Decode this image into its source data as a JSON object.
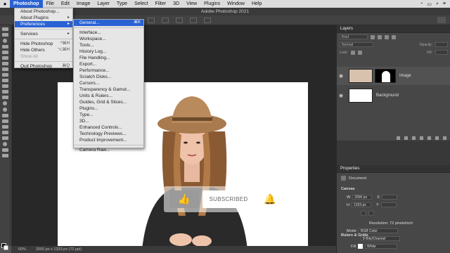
{
  "menubar": {
    "items": [
      "Photoshop",
      "File",
      "Edit",
      "Image",
      "Layer",
      "Type",
      "Select",
      "Filter",
      "3D",
      "View",
      "Plugins",
      "Window",
      "Help"
    ]
  },
  "title": "Adobe Photoshop 2021",
  "photoshop_menu": {
    "items": [
      {
        "label": "About Photoshop...",
        "shortcut": ""
      },
      {
        "label": "About Plugins",
        "shortcut": "▸"
      },
      {
        "label": "Preferences",
        "shortcut": "▸"
      },
      {
        "label": "Services",
        "shortcut": "▸"
      },
      {
        "label": "Hide Photoshop",
        "shortcut": "^⌘H"
      },
      {
        "label": "Hide Others",
        "shortcut": "⌥⌘H"
      },
      {
        "label": "Show All",
        "shortcut": ""
      },
      {
        "label": "Quit Photoshop",
        "shortcut": "⌘Q"
      }
    ]
  },
  "preferences_menu": {
    "items": [
      {
        "label": "General...",
        "shortcut": "⌘K"
      },
      {
        "label": "Interface..."
      },
      {
        "label": "Workspace..."
      },
      {
        "label": "Tools..."
      },
      {
        "label": "History Log..."
      },
      {
        "label": "File Handling..."
      },
      {
        "label": "Export..."
      },
      {
        "label": "Performance..."
      },
      {
        "label": "Scratch Disks..."
      },
      {
        "label": "Cursors..."
      },
      {
        "label": "Transparency & Gamut..."
      },
      {
        "label": "Units & Rulers..."
      },
      {
        "label": "Guides, Grid & Slices..."
      },
      {
        "label": "Plugins..."
      },
      {
        "label": "Type..."
      },
      {
        "label": "3D..."
      },
      {
        "label": "Enhanced Controls..."
      },
      {
        "label": "Technology Previews..."
      },
      {
        "label": "Product Improvement..."
      },
      {
        "label": "Camera Raw..."
      }
    ]
  },
  "layers_panel": {
    "tab": "Layers",
    "kind": "Kind",
    "mode": "Normal",
    "opacity_label": "Opacity:",
    "fill_label": "Fill:",
    "layers": [
      {
        "name": "Image"
      },
      {
        "name": "Background"
      }
    ]
  },
  "properties_panel": {
    "tab": "Properties",
    "doc_label": "Document",
    "canvas_label": "Canvas",
    "w_label": "W",
    "w_value": "2000 px",
    "h_label": "H",
    "h_value": "1333 px",
    "x_label": "X",
    "y_label": "Y",
    "resolution": "Resolution: 72 pixels/inch",
    "mode_label": "Mode",
    "mode_value": "RGB Color",
    "depth_value": "8 Bits/Channel",
    "fill_label": "Fill",
    "fill_value": "White",
    "rulers_label": "Rulers & Grids"
  },
  "status": {
    "zoom": "60%",
    "info": "2000 px x 1333 px (72 ppi)"
  },
  "overlay": {
    "subscribe_label": "SUBSCRIBED"
  },
  "colors": {
    "accent": "#2a62d4",
    "hat": "#a87a4e",
    "hair": "#8a5a33",
    "jacket": "#2a2a2a"
  }
}
